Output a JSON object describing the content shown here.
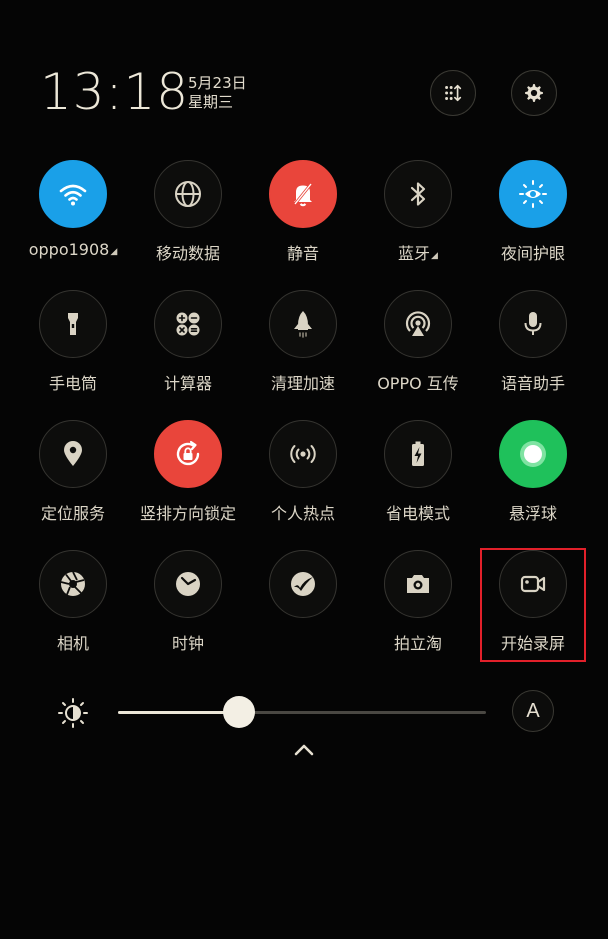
{
  "status": {
    "time": "13:18",
    "date": "5月23日",
    "weekday": "星期三"
  },
  "header": {
    "edit_icon": "grid-sort-icon",
    "settings_icon": "gear-icon"
  },
  "colors": {
    "wifi_active": "#1aa0e8",
    "mute_active": "#e9453b",
    "float_ball_active": "#1fc15b",
    "highlight_border": "#e2202a"
  },
  "tiles": [
    {
      "id": "wifi",
      "label": "oppo1908",
      "caret": true,
      "icon": "wifi-icon",
      "active": "blue"
    },
    {
      "id": "mobile-data",
      "label": "移动数据",
      "icon": "globe-icon"
    },
    {
      "id": "mute",
      "label": "静音",
      "icon": "bell-off-icon",
      "active": "red"
    },
    {
      "id": "bluetooth",
      "label": "蓝牙",
      "caret": true,
      "icon": "bluetooth-icon"
    },
    {
      "id": "night-mode",
      "label": "夜间护眼",
      "icon": "eye-sun-icon",
      "active": "blue"
    },
    {
      "id": "flashlight",
      "label": "手电筒",
      "icon": "flashlight-icon"
    },
    {
      "id": "calculator",
      "label": "计算器",
      "icon": "calculator-icon"
    },
    {
      "id": "speed-clean",
      "label": "清理加速",
      "icon": "rocket-icon"
    },
    {
      "id": "oppo-share",
      "label": "OPPO 互传",
      "icon": "share-signal-icon"
    },
    {
      "id": "voice-assistant",
      "label": "语音助手",
      "icon": "microphone-icon"
    },
    {
      "id": "location",
      "label": "定位服务",
      "icon": "location-pin-icon"
    },
    {
      "id": "rotation-lock",
      "label": "竖排方向锁定",
      "icon": "rotation-lock-icon",
      "active": "red"
    },
    {
      "id": "hotspot",
      "label": "个人热点",
      "icon": "hotspot-icon"
    },
    {
      "id": "power-saving",
      "label": "省电模式",
      "icon": "battery-bolt-icon"
    },
    {
      "id": "float-ball",
      "label": "悬浮球",
      "icon": "float-ball-icon",
      "active": "green"
    },
    {
      "id": "camera",
      "label": "相机",
      "icon": "camera-shutter-icon"
    },
    {
      "id": "clock",
      "label": "时钟",
      "icon": "clock-icon"
    },
    {
      "id": "unknown-app",
      "label": "",
      "icon": "swoosh-icon"
    },
    {
      "id": "photo-taobao",
      "label": "拍立淘",
      "icon": "camera-icon"
    },
    {
      "id": "screen-record",
      "label": "开始录屏",
      "icon": "video-camera-icon"
    }
  ],
  "brightness": {
    "level": 0.33,
    "auto_label": "A"
  }
}
